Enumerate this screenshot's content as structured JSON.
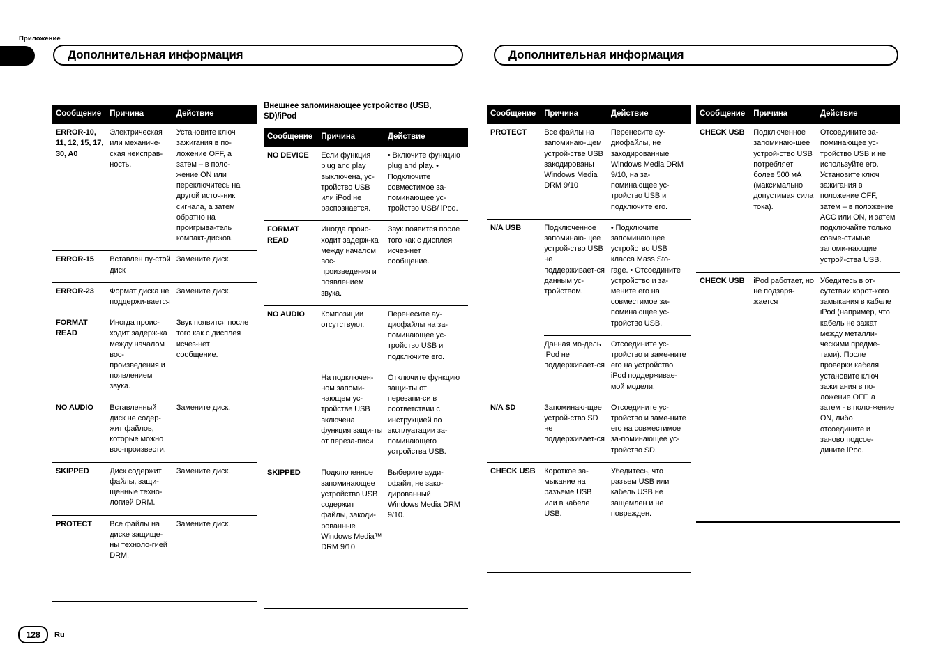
{
  "page": {
    "section_tab": "Приложение",
    "chapter_title_left": "Дополнительная информация",
    "chapter_title_right": "Дополнительная информация",
    "folio_number": "128",
    "folio_language": "Ru"
  },
  "headings": {
    "external_storage": "Внешнее запоминающее устройство (USB, SD)/iPod"
  },
  "table_headers": {
    "message": "Сообщение",
    "cause": "Причина",
    "action": "Действие"
  },
  "tables": {
    "built_in_cd": {
      "rows": [
        {
          "message": "ERROR-10, 11, 12, 15, 17, 30, A0",
          "cause": "Электрическая или механиче-ская неисправ-ность.",
          "action": "Установите ключ зажигания в по-ложение OFF, а затем – в поло-жение ON или переключитесь на другой источ-ник сигнала, а затем обратно на проигрыва-тель компакт-дисков."
        },
        {
          "message": "ERROR-15",
          "cause": "Вставлен пу-стой диск",
          "action": "Замените диск."
        },
        {
          "message": "ERROR-23",
          "cause": "Формат диска не поддержи-вается",
          "action": "Замените диск."
        },
        {
          "message": "FORMAT READ",
          "cause": "Иногда проис-ходит задерж-ка между началом вос-произведения и появлением звука.",
          "action": "Звук появится после того как с дисплея исчез-нет сообщение."
        },
        {
          "message": "NO AUDIO",
          "cause": "Вставленный диск не содер-жит файлов, которые можно вос-произвести.",
          "action": "Замените диск."
        },
        {
          "message": "SKIPPED",
          "cause": "Диск содержит файлы, защи-щенные техно-логией DRM.",
          "action": "Замените диск."
        },
        {
          "message": "PROTECT",
          "cause": "Все файлы на диске защище-ны техноло-гией DRM.",
          "action": "Замените диск."
        }
      ]
    },
    "external_storage": {
      "rows": [
        {
          "message": "NO DEVICE",
          "cause": "Если функция plug and play выключена, ус-тройство USB или iPod не распознается.",
          "action": "• Включите функцию plug and play. • Подключите совместимое за-поминающее ус-тройство USB/ iPod.",
          "continuation": false
        },
        {
          "message": "FORMAT READ",
          "cause": "Иногда проис-ходит задерж-ка между началом вос-произведения и появлением звука.",
          "action": "Звук появится после того как с дисплея исчез-нет сообщение.",
          "continuation": false
        },
        {
          "message": "NO AUDIO",
          "cause": "Композиции отсутствуют.",
          "action": "Перенесите ау-диофайлы на за-поминающее ус-тройство USB и подключите его.",
          "continuation": false
        },
        {
          "message": "",
          "cause": "На подключен-ном запоми-нающем ус-тройстве USB включена функция защи-ты от переза-писи",
          "action": "Отключите функцию защи-ты от перезапи-си в соответствии с инструкцией по эксплуатации за-поминающего устройства USB.",
          "continuation": true
        },
        {
          "message": "SKIPPED",
          "cause": "Подключенное запоминающее устройство USB содержит файлы, закоди-рованные Windows Media™ DRM 9/10",
          "action": "Выберите ауди-офайл, не зако-дированный Windows Media DRM 9/10.",
          "continuation": false
        }
      ]
    },
    "external_storage_cont": {
      "rows": [
        {
          "message": "PROTECT",
          "cause": "Все файлы на запоминаю-щем устрой-стве USB закодированы Windows Media DRM 9/10",
          "action": "Перенесите ау-диофайлы, не закодированные Windows Media DRM 9/10, на за-поминающее ус-тройство USB и подключите его.",
          "continuation": false
        },
        {
          "message": "N/A USB",
          "cause": "Подключенное запоминаю-щее устрой-ство USB не поддерживает-ся данным ус-тройством.",
          "action": "• Подключите запоминающее устройство USB класса Mass Sto-rage. • Отсоедините устройство и за-мените его на совместимое за-поминающее ус-тройство USB.",
          "continuation": false
        },
        {
          "message": "",
          "cause": "Данная мо-дель iPod не поддерживает-ся",
          "action": "Отсоедините ус-тройство и заме-ните его на устройство iPod поддерживае-мой модели.",
          "continuation": true
        },
        {
          "message": "N/A SD",
          "cause": "Запоминаю-щее устрой-ство SD не поддерживает-ся",
          "action": "Отсоедините ус-тройство и заме-ните его на совместимое за-поминающее ус-тройство SD.",
          "continuation": false
        },
        {
          "message": "CHECK USB",
          "cause": "Короткое за-мыкание на разъеме USB или в кабеле USB.",
          "action": "Убедитесь, что разъем USB или кабель USB не защемлен и не поврежден.",
          "continuation": false
        }
      ]
    },
    "external_storage_cont2": {
      "rows": [
        {
          "message": "CHECK USB",
          "cause": "Подключенное запоминаю-щее устрой-ство USB потребляет более 500 мА (максимально допустимая сила тока).",
          "action": "Отсоедините за-поминающее ус-тройство USB и не используйте его. Установите ключ зажигания в положение OFF, затем – в положение ACC или ON, и затем подключайте только совме-стимые запоми-нающие устрой-ства USB.",
          "continuation": false
        },
        {
          "message": "CHECK USB",
          "cause": "iPod работает, но не подзаря-жается",
          "action": "Убедитесь в от-сутствии корот-кого замыкания в кабеле iPod (например, что кабель не зажат между металли-ческими предме-тами). После проверки кабеля установите ключ зажигания в по-ложение OFF, а затем - в поло-жение ON, либо отсоедините и заново подсое-дините iPod.",
          "continuation": false
        }
      ]
    }
  }
}
